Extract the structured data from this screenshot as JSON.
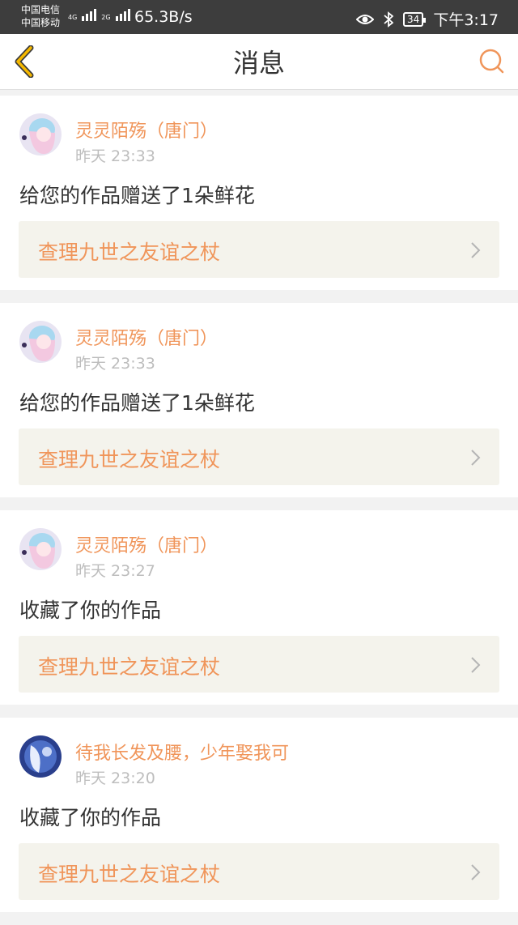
{
  "status_bar": {
    "carrier1": "中国电信",
    "carrier2": "中国移动",
    "net1": "4G",
    "net2": "2G",
    "speed": "65.3B/s",
    "battery": "34",
    "time": "下午3:17"
  },
  "header": {
    "title": "消息"
  },
  "messages": [
    {
      "username": "灵灵陌殇（唐门）",
      "time": "昨天 23:33",
      "text": "给您的作品赠送了1朵鲜花",
      "work": "查理九世之友谊之杖"
    },
    {
      "username": "灵灵陌殇（唐门）",
      "time": "昨天 23:33",
      "text": "给您的作品赠送了1朵鲜花",
      "work": "查理九世之友谊之杖"
    },
    {
      "username": "灵灵陌殇（唐门）",
      "time": "昨天 23:27",
      "text": "收藏了你的作品",
      "work": "查理九世之友谊之杖"
    },
    {
      "username": "待我长发及腰，少年娶我可",
      "time": "昨天 23:20",
      "text": "收藏了你的作品",
      "work": "查理九世之友谊之杖"
    }
  ],
  "colors": {
    "accent": "#f0955a",
    "back_arrow": "#f5b800",
    "link_bg": "#f4f3ec"
  },
  "icons": [
    "back-arrow-icon",
    "search-icon",
    "chevron-right-icon",
    "eye-icon",
    "bluetooth-icon",
    "battery-icon"
  ]
}
